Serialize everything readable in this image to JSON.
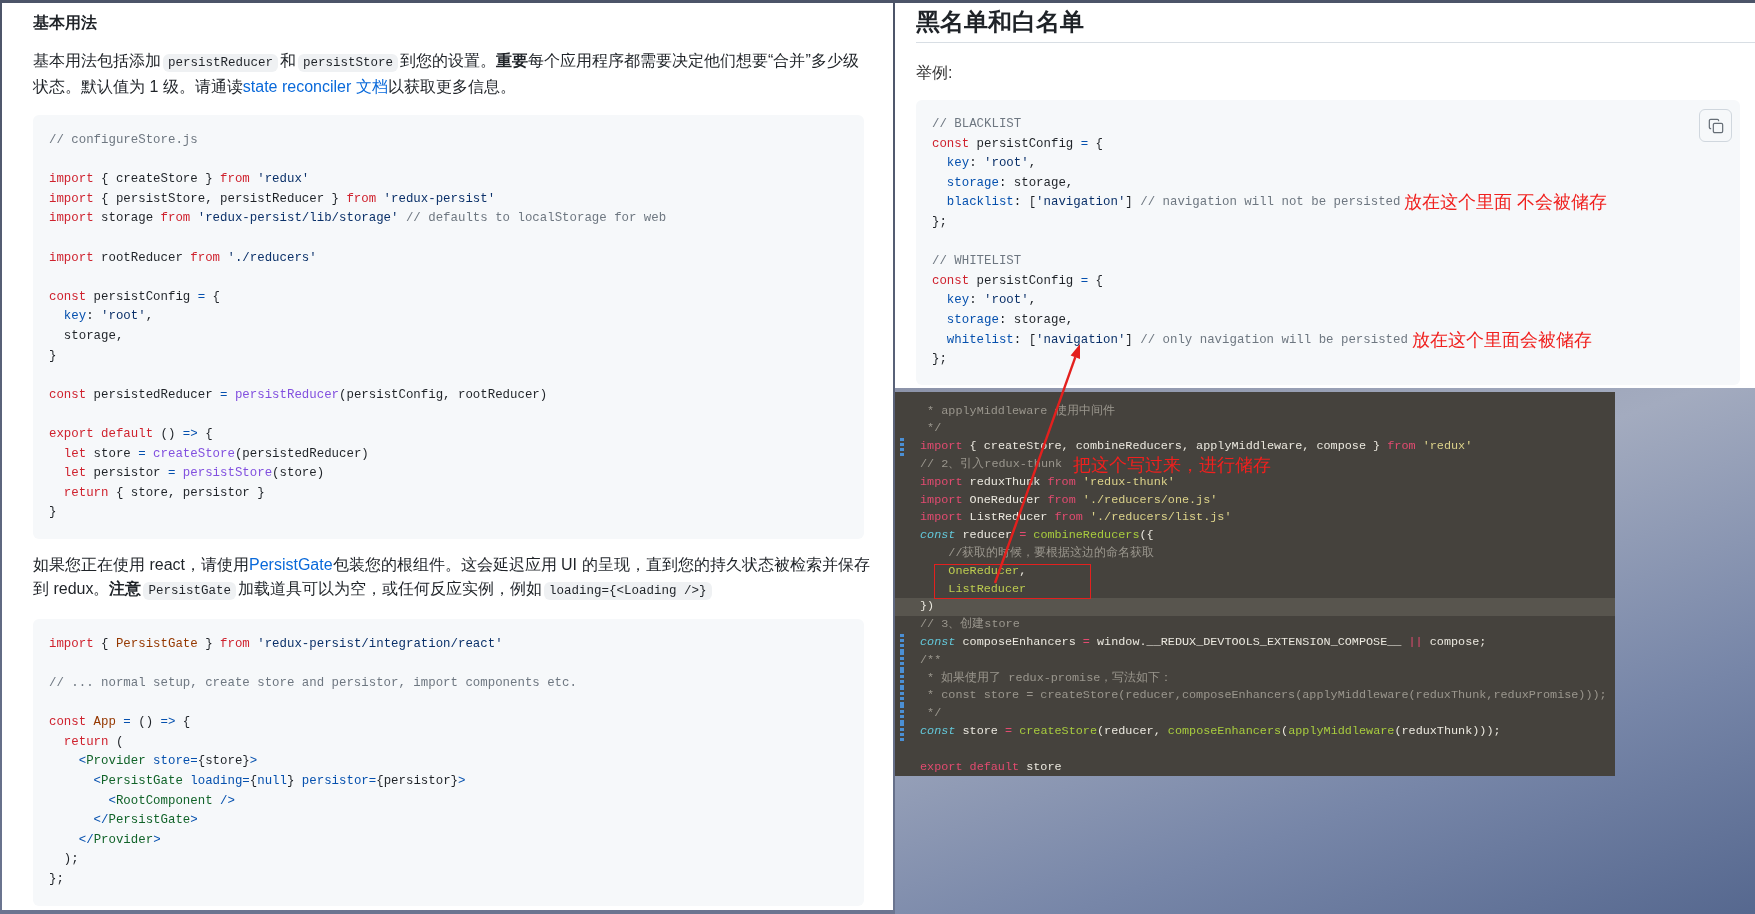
{
  "left_document": {
    "blocks": [
      {
        "kind": "heading",
        "text": "基本用法"
      },
      {
        "kind": "paragraph",
        "segments": [
          {
            "kind": "text",
            "text": "基本用法包括添加"
          },
          {
            "kind": "code",
            "text": "persistReducer"
          },
          {
            "kind": "text",
            "text": "和"
          },
          {
            "kind": "code",
            "text": "persistStore"
          },
          {
            "kind": "text",
            "text": "到您的设置。**重要**每个应用程序都需要决定他们想要“合并”多少级状态。默认值为 1 级。请通读"
          },
          {
            "kind": "link",
            "text": "state reconciler 文档"
          },
          {
            "kind": "text",
            "text": "以获取更多信息。"
          }
        ]
      },
      {
        "kind": "code",
        "groups": [
          [
            {
              "tokens": [
                {
                  "kind": "comment",
                  "text": "// configureStore.js"
                }
              ]
            }
          ],
          [
            {
              "tokens": [
                {
                  "kind": "keyword",
                  "text": "import"
                },
                {
                  "kind": "plain",
                  "text": " { createStore } "
                },
                {
                  "kind": "keyword",
                  "text": "from"
                },
                {
                  "kind": "string",
                  "text": " 'redux'"
                }
              ]
            },
            {
              "tokens": [
                {
                  "kind": "keyword",
                  "text": "import"
                },
                {
                  "kind": "plain",
                  "text": " { persistStore, persistReducer } "
                },
                {
                  "kind": "keyword",
                  "text": "from"
                },
                {
                  "kind": "string",
                  "text": " 'redux-persist'"
                }
              ]
            },
            {
              "tokens": [
                {
                  "kind": "keyword",
                  "text": "import"
                },
                {
                  "kind": "plain",
                  "text": " storage "
                },
                {
                  "kind": "keyword",
                  "text": "from"
                },
                {
                  "kind": "string",
                  "text": " 'redux-persist/lib/storage'"
                },
                {
                  "kind": "comment",
                  "text": " // defaults to localStorage for web"
                }
              ]
            }
          ],
          [
            {
              "tokens": [
                {
                  "kind": "keyword",
                  "text": "import"
                },
                {
                  "kind": "plain",
                  "text": " rootReducer "
                },
                {
                  "kind": "keyword",
                  "text": "from"
                },
                {
                  "kind": "string",
                  "text": " './reducers'"
                }
              ]
            }
          ],
          [
            {
              "tokens": [
                {
                  "kind": "keyword",
                  "text": "const"
                },
                {
                  "kind": "plain",
                  "text": " persistConfig "
                },
                {
                  "kind": "operator",
                  "text": "="
                },
                {
                  "kind": "plain",
                  "text": " {"
                }
              ]
            },
            {
              "tokens": [
                {
                  "kind": "property",
                  "text": "  key"
                },
                {
                  "kind": "plain",
                  "text": ": "
                },
                {
                  "kind": "string",
                  "text": "'root'"
                },
                {
                  "kind": "plain",
                  "text": ","
                }
              ]
            },
            {
              "tokens": [
                {
                  "kind": "plain",
                  "text": "  storage,"
                }
              ]
            },
            {
              "tokens": [
                {
                  "kind": "plain",
                  "text": "}"
                }
              ]
            }
          ],
          [
            {
              "tokens": [
                {
                  "kind": "keyword",
                  "text": "const"
                },
                {
                  "kind": "plain",
                  "text": " persistedReducer "
                },
                {
                  "kind": "operator",
                  "text": "="
                },
                {
                  "kind": "function",
                  "text": " persistReducer"
                },
                {
                  "kind": "plain",
                  "text": "(persistConfig, rootReducer)"
                }
              ]
            }
          ],
          [
            {
              "tokens": [
                {
                  "kind": "keyword",
                  "text": "export default"
                },
                {
                  "kind": "plain",
                  "text": " () "
                },
                {
                  "kind": "operator",
                  "text": "=>"
                },
                {
                  "kind": "plain",
                  "text": " {"
                }
              ]
            },
            {
              "tokens": [
                {
                  "kind": "keyword",
                  "text": "  let"
                },
                {
                  "kind": "plain",
                  "text": " store "
                },
                {
                  "kind": "operator",
                  "text": "="
                },
                {
                  "kind": "function",
                  "text": " createStore"
                },
                {
                  "kind": "plain",
                  "text": "(persistedReducer)"
                }
              ]
            },
            {
              "tokens": [
                {
                  "kind": "keyword",
                  "text": "  let"
                },
                {
                  "kind": "plain",
                  "text": " persistor "
                },
                {
                  "kind": "operator",
                  "text": "="
                },
                {
                  "kind": "function",
                  "text": " persistStore"
                },
                {
                  "kind": "plain",
                  "text": "(store)"
                }
              ]
            },
            {
              "tokens": [
                {
                  "kind": "keyword",
                  "text": "  return"
                },
                {
                  "kind": "plain",
                  "text": " { store, persistor }"
                }
              ]
            },
            {
              "tokens": [
                {
                  "kind": "plain",
                  "text": "}"
                }
              ]
            }
          ]
        ]
      },
      {
        "kind": "paragraph",
        "segments": [
          {
            "kind": "text",
            "text": "如果您正在使用 react，请使用"
          },
          {
            "kind": "link",
            "text": "PersistGate"
          },
          {
            "kind": "text",
            "text": "包装您的根组件。这会延迟应用 UI 的呈现，直到您的持久状态被检索并保存到 redux。**注意**"
          },
          {
            "kind": "code",
            "text": "PersistGate"
          },
          {
            "kind": "text",
            "text": "加载道具可以为空，或任何反应实例，例如"
          },
          {
            "kind": "code",
            "text": "loading={<Loading />}"
          }
        ]
      },
      {
        "kind": "code",
        "groups": [
          [
            {
              "tokens": [
                {
                  "kind": "keyword",
                  "text": "import"
                },
                {
                  "kind": "plain",
                  "text": " { "
                },
                {
                  "kind": "entity",
                  "text": "PersistGate"
                },
                {
                  "kind": "plain",
                  "text": " } "
                },
                {
                  "kind": "keyword",
                  "text": "from"
                },
                {
                  "kind": "string",
                  "text": " 'redux-persist/integration/react'"
                }
              ]
            }
          ],
          [
            {
              "tokens": [
                {
                  "kind": "comment",
                  "text": "// ... normal setup, create store and persistor, import components etc."
                }
              ]
            }
          ],
          [
            {
              "tokens": [
                {
                  "kind": "keyword",
                  "text": "const"
                },
                {
                  "kind": "entity",
                  "text": " App"
                },
                {
                  "kind": "operator",
                  "text": " ="
                },
                {
                  "kind": "plain",
                  "text": " () "
                },
                {
                  "kind": "operator",
                  "text": "=>"
                },
                {
                  "kind": "plain",
                  "text": " {"
                }
              ]
            },
            {
              "tokens": [
                {
                  "kind": "keyword",
                  "text": "  return"
                },
                {
                  "kind": "plain",
                  "text": " ("
                }
              ]
            },
            {
              "tokens": [
                {
                  "kind": "operator",
                  "text": "    <"
                },
                {
                  "kind": "tag",
                  "text": "Provider"
                },
                {
                  "kind": "property",
                  "text": " store"
                },
                {
                  "kind": "operator",
                  "text": "="
                },
                {
                  "kind": "plain",
                  "text": "{store}"
                },
                {
                  "kind": "operator",
                  "text": ">"
                }
              ]
            },
            {
              "tokens": [
                {
                  "kind": "operator",
                  "text": "      <"
                },
                {
                  "kind": "tag",
                  "text": "PersistGate"
                },
                {
                  "kind": "property",
                  "text": " loading"
                },
                {
                  "kind": "operator",
                  "text": "="
                },
                {
                  "kind": "plain",
                  "text": "{"
                },
                {
                  "kind": "property",
                  "text": "null"
                },
                {
                  "kind": "plain",
                  "text": "}"
                },
                {
                  "kind": "property",
                  "text": " persistor"
                },
                {
                  "kind": "operator",
                  "text": "="
                },
                {
                  "kind": "plain",
                  "text": "{persistor}"
                },
                {
                  "kind": "operator",
                  "text": ">"
                }
              ]
            },
            {
              "tokens": [
                {
                  "kind": "operator",
                  "text": "        <"
                },
                {
                  "kind": "tag",
                  "text": "RootComponent"
                },
                {
                  "kind": "operator",
                  "text": " />"
                }
              ]
            },
            {
              "tokens": [
                {
                  "kind": "operator",
                  "text": "      </"
                },
                {
                  "kind": "tag",
                  "text": "PersistGate"
                },
                {
                  "kind": "operator",
                  "text": ">"
                }
              ]
            },
            {
              "tokens": [
                {
                  "kind": "operator",
                  "text": "    </"
                },
                {
                  "kind": "tag",
                  "text": "Provider"
                },
                {
                  "kind": "operator",
                  "text": ">"
                }
              ]
            },
            {
              "tokens": [
                {
                  "kind": "plain",
                  "text": "  );"
                }
              ]
            },
            {
              "tokens": [
                {
                  "kind": "plain",
                  "text": "};"
                }
              ]
            }
          ]
        ]
      }
    ]
  },
  "right_document": {
    "heading": "黑名单和白名单",
    "label": "举例:",
    "code_block": {
      "groups": [
        [
          {
            "tokens": [
              {
                "kind": "comment",
                "text": "// BLACKLIST"
              }
            ]
          },
          {
            "tokens": [
              {
                "kind": "keyword",
                "text": "const"
              },
              {
                "kind": "plain",
                "text": " persistConfig "
              },
              {
                "kind": "operator",
                "text": "="
              },
              {
                "kind": "plain",
                "text": " {"
              }
            ]
          },
          {
            "tokens": [
              {
                "kind": "property",
                "text": "  key"
              },
              {
                "kind": "plain",
                "text": ": "
              },
              {
                "kind": "string",
                "text": "'root'"
              },
              {
                "kind": "plain",
                "text": ","
              }
            ]
          },
          {
            "tokens": [
              {
                "kind": "property",
                "text": "  storage"
              },
              {
                "kind": "plain",
                "text": ": storage,"
              }
            ]
          },
          {
            "tokens": [
              {
                "kind": "property",
                "text": "  blacklist"
              },
              {
                "kind": "plain",
                "text": ": ["
              },
              {
                "kind": "string",
                "text": "'navigation'"
              },
              {
                "kind": "plain",
                "text": "]"
              },
              {
                "kind": "comment",
                "text": " // navigation will not be persisted"
              }
            ],
            "annotation": "放在这个里面 不会被储存"
          },
          {
            "tokens": [
              {
                "kind": "plain",
                "text": "};"
              }
            ]
          }
        ],
        [
          {
            "tokens": [
              {
                "kind": "comment",
                "text": "// WHITELIST"
              }
            ]
          },
          {
            "tokens": [
              {
                "kind": "keyword",
                "text": "const"
              },
              {
                "kind": "plain",
                "text": " persistConfig "
              },
              {
                "kind": "operator",
                "text": "="
              },
              {
                "kind": "plain",
                "text": " {"
              }
            ]
          },
          {
            "tokens": [
              {
                "kind": "property",
                "text": "  key"
              },
              {
                "kind": "plain",
                "text": ": "
              },
              {
                "kind": "string",
                "text": "'root'"
              },
              {
                "kind": "plain",
                "text": ","
              }
            ]
          },
          {
            "tokens": [
              {
                "kind": "property",
                "text": "  storage"
              },
              {
                "kind": "plain",
                "text": ": storage,"
              }
            ]
          },
          {
            "tokens": [
              {
                "kind": "property",
                "text": "  whitelist"
              },
              {
                "kind": "plain",
                "text": ": ["
              },
              {
                "kind": "string",
                "text": "'navigation'"
              },
              {
                "kind": "plain",
                "text": "]"
              },
              {
                "kind": "comment",
                "text": " // only navigation will be persisted"
              }
            ],
            "annotation": "放在这个里面会被储存"
          },
          {
            "tokens": [
              {
                "kind": "plain",
                "text": "};"
              }
            ]
          }
        ]
      ]
    }
  },
  "code_editor": {
    "annotation": "把这个写过来，进行储存",
    "groups": [
      [
        {
          "changed": false,
          "current": false,
          "tokens": [
            {
              "kind": "comment",
              "text": " * applyMiddleware 使用中间件"
            }
          ]
        },
        {
          "changed": false,
          "current": false,
          "tokens": [
            {
              "kind": "comment",
              "text": " */"
            }
          ]
        },
        {
          "changed": true,
          "current": false,
          "tokens": [
            {
              "kind": "keyword",
              "text": "import"
            },
            {
              "kind": "plain",
              "text": " { createStore, combineReducers, applyMiddleware, compose } "
            },
            {
              "kind": "keyword",
              "text": "from"
            },
            {
              "kind": "string",
              "text": " 'redux'"
            }
          ]
        },
        {
          "changed": false,
          "current": false,
          "tokens": [
            {
              "kind": "comment",
              "text": "// 2、引入redux-thunk"
            }
          ]
        },
        {
          "changed": false,
          "current": false,
          "tokens": [
            {
              "kind": "keyword",
              "text": "import"
            },
            {
              "kind": "plain",
              "text": " reduxThunk "
            },
            {
              "kind": "keyword",
              "text": "from"
            },
            {
              "kind": "string",
              "text": " 'redux-thunk'"
            }
          ]
        },
        {
          "changed": false,
          "current": false,
          "tokens": [
            {
              "kind": "keyword",
              "text": "import"
            },
            {
              "kind": "plain",
              "text": " OneReducer "
            },
            {
              "kind": "keyword",
              "text": "from"
            },
            {
              "kind": "string",
              "text": " './reducers/one.js'"
            }
          ]
        },
        {
          "changed": false,
          "current": false,
          "tokens": [
            {
              "kind": "keyword",
              "text": "import"
            },
            {
              "kind": "plain",
              "text": " ListReducer "
            },
            {
              "kind": "keyword",
              "text": "from"
            },
            {
              "kind": "string",
              "text": " './reducers/list.js'"
            }
          ]
        },
        {
          "changed": false,
          "current": false,
          "tokens": [
            {
              "kind": "declaration",
              "text": "const"
            },
            {
              "kind": "plain",
              "text": " reducer "
            },
            {
              "kind": "operator",
              "text": "="
            },
            {
              "kind": "function",
              "text": " combineReducers"
            },
            {
              "kind": "plain",
              "text": "({"
            }
          ]
        },
        {
          "changed": false,
          "current": false,
          "tokens": [
            {
              "kind": "comment",
              "text": "    //获取的时候，要根据这边的命名获取"
            }
          ]
        },
        {
          "changed": false,
          "current": false,
          "tokens": [
            {
              "kind": "property",
              "text": "    OneReducer"
            },
            {
              "kind": "plain",
              "text": ","
            }
          ]
        },
        {
          "changed": false,
          "current": false,
          "tokens": [
            {
              "kind": "property",
              "text": "    ListReducer"
            }
          ]
        },
        {
          "changed": false,
          "current": true,
          "tokens": [
            {
              "kind": "plain",
              "text": "})"
            }
          ]
        },
        {
          "changed": false,
          "current": false,
          "tokens": [
            {
              "kind": "comment",
              "text": "// 3、创建store"
            }
          ]
        },
        {
          "changed": true,
          "current": false,
          "tokens": [
            {
              "kind": "declaration",
              "text": "const"
            },
            {
              "kind": "plain",
              "text": " composeEnhancers "
            },
            {
              "kind": "operator",
              "text": "="
            },
            {
              "kind": "plain",
              "text": " window.__REDUX_DEVTOOLS_EXTENSION_COMPOSE__ "
            },
            {
              "kind": "operator",
              "text": "||"
            },
            {
              "kind": "plain",
              "text": " compose;"
            }
          ]
        },
        {
          "changed": true,
          "current": false,
          "tokens": [
            {
              "kind": "comment",
              "text": "/**"
            }
          ]
        },
        {
          "changed": true,
          "current": false,
          "tokens": [
            {
              "kind": "comment",
              "text": " * 如果使用了 redux-promise，写法如下："
            }
          ]
        },
        {
          "changed": true,
          "current": false,
          "tokens": [
            {
              "kind": "comment",
              "text": " * const store = createStore(reducer,composeEnhancers(applyMiddleware(reduxThunk,reduxPromise)));"
            }
          ]
        },
        {
          "changed": true,
          "current": false,
          "tokens": [
            {
              "kind": "comment",
              "text": " */"
            }
          ]
        },
        {
          "changed": true,
          "current": false,
          "tokens": [
            {
              "kind": "declaration",
              "text": "const"
            },
            {
              "kind": "plain",
              "text": " store "
            },
            {
              "kind": "operator",
              "text": "="
            },
            {
              "kind": "function",
              "text": " createStore"
            },
            {
              "kind": "plain",
              "text": "(reducer, "
            },
            {
              "kind": "function",
              "text": "composeEnhancers"
            },
            {
              "kind": "plain",
              "text": "("
            },
            {
              "kind": "function",
              "text": "applyMiddleware"
            },
            {
              "kind": "plain",
              "text": "(reduxThunk)));"
            }
          ]
        }
      ],
      [
        {
          "changed": false,
          "current": false,
          "tokens": [
            {
              "kind": "keyword",
              "text": "export default"
            },
            {
              "kind": "plain",
              "text": " store"
            }
          ]
        }
      ]
    ]
  }
}
